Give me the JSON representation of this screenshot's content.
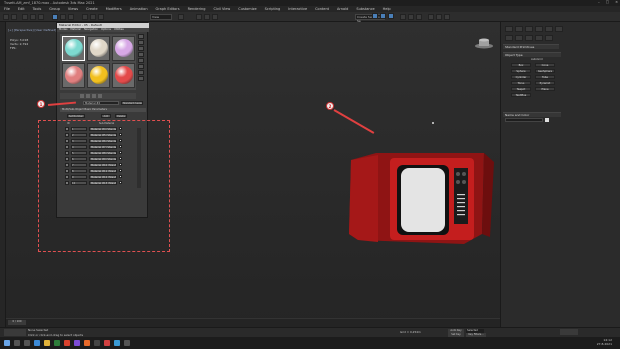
{
  "window": {
    "title": "Tvsett-AM_zmf_1870.max - Autodesk 3ds Max 2021"
  },
  "menubar": [
    "File",
    "Edit",
    "Tools",
    "Group",
    "Views",
    "Create",
    "Modifiers",
    "Animation",
    "Graph Editors",
    "Rendering",
    "Civil View",
    "Customize",
    "Scripting",
    "Interactive",
    "Content",
    "Arnold",
    "Substance",
    "Help"
  ],
  "toolbar": {
    "view_select": "View",
    "selection_set": "Create Selection Se"
  },
  "viewport": {
    "label": "[+] [Perspective] [User Defined] [Default Shading]",
    "hud": [
      "Polys: 3,018",
      "Verts: 2,794",
      "FPS:"
    ]
  },
  "command_panel": {
    "category": "Standard Primitives",
    "rollout_object_type": "Object Type",
    "autogrid": "AutoGrid",
    "object_types": [
      "Box",
      "Cone",
      "Sphere",
      "GeoSphere",
      "Cylinder",
      "Tube",
      "Torus",
      "Pyramid",
      "Teapot",
      "Plane",
      "TextPlus"
    ],
    "rollout_name_color": "Name and Color"
  },
  "material_dialog": {
    "title": "Material Editor - 05 - Default",
    "menu": [
      "Modes",
      "Material",
      "Navigation",
      "Options",
      "Utilities"
    ],
    "material_name": "Material #2",
    "material_type": "Standard (Legacy)",
    "rollout": "Multi/Sub-Object Basic Parameters",
    "set_number": "Set Number",
    "add": "Add",
    "delete": "Delete",
    "header_id": "ID",
    "header_name": "Sub-Material",
    "slots": [
      {
        "id": "1",
        "map": "Material #4 (Standard)"
      },
      {
        "id": "2",
        "map": "Material #5 (Standard)"
      },
      {
        "id": "3",
        "map": "Material #6 (Standard)"
      },
      {
        "id": "4",
        "map": "Material #7 (Standard)"
      },
      {
        "id": "5",
        "map": "Material #8 (Standard)"
      },
      {
        "id": "6",
        "map": "Material #9 (Standard)"
      },
      {
        "id": "7",
        "map": "Material #10 (Standard)"
      },
      {
        "id": "8",
        "map": "Material #11 (Standard)"
      },
      {
        "id": "9",
        "map": "Material #12 (Standard)"
      },
      {
        "id": "10",
        "map": "Material #13 (Standard)"
      }
    ],
    "sphere_colors": [
      "#7dd9d0",
      "#e0d7c8",
      "#d7a8e6",
      "#e07f7f",
      "#f2c01e",
      "#e34a4a"
    ]
  },
  "callouts": [
    "1",
    "2"
  ],
  "colors": {
    "accent": "#e04040",
    "tv_body": "#b81c1c",
    "toolbar_active": "#4a7fb8"
  },
  "timeline": {
    "frame": "0 / 100"
  },
  "status": {
    "selection": "None Selected",
    "prompt": "Click or click-and-drag to select objects",
    "grid": "Grid = 0,254m",
    "autokey": "Auto Key",
    "selected": "Selected",
    "setkey": "Set Key",
    "keyfilters": "Key Filters..."
  },
  "taskbar": {
    "time": "14:12",
    "date": "27.8.2021"
  }
}
